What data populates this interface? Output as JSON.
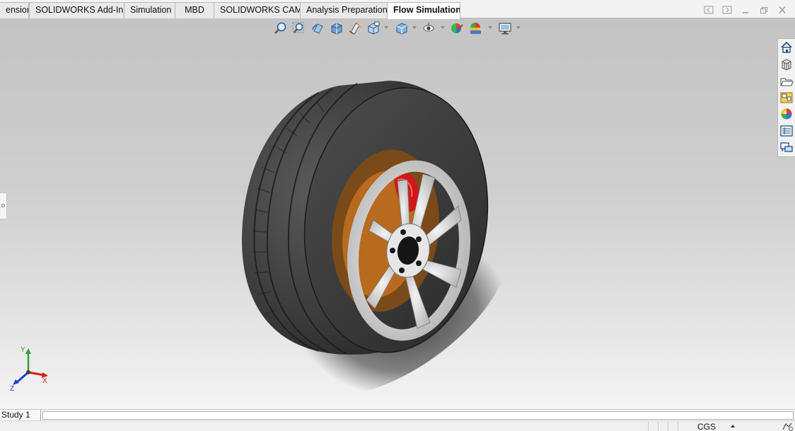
{
  "command_manager": {
    "tabs": [
      {
        "label": "ensions"
      },
      {
        "label": "SOLIDWORKS Add-Ins"
      },
      {
        "label": "Simulation"
      },
      {
        "label": "MBD"
      },
      {
        "label": "SOLIDWORKS CAM"
      },
      {
        "label": "Analysis Preparation"
      },
      {
        "label": "Flow Simulation"
      }
    ],
    "active_tab": "Flow Simulation"
  },
  "window_controls": {
    "icons": [
      "tile-left-icon",
      "tile-right-icon",
      "minimize-icon",
      "restore-icon",
      "close-icon"
    ]
  },
  "heads_up_toolbar": {
    "icons": [
      "zoom-to-fit-icon",
      "zoom-to-area-icon",
      "previous-view-icon",
      "section-view-icon",
      "dynamic-annotation-icon",
      "view-orientation-icon",
      "display-style-icon",
      "hide-show-items-icon",
      "edit-appearance-icon",
      "apply-scene-icon",
      "view-settings-icon"
    ]
  },
  "task_pane": {
    "icons": [
      "home-icon",
      "design-library-icon",
      "file-explorer-icon",
      "view-palette-icon",
      "appearances-icon",
      "custom-properties-icon",
      "forum-icon"
    ]
  },
  "model": {
    "description_icon": "wheel-assembly-model",
    "tire_color": "#3c3c3c",
    "rim_color": "#d8d8d8",
    "caliper_color": "#d01818",
    "rotor_color": "#b86a1e"
  },
  "triad": {
    "x_label": "X",
    "y_label": "Y",
    "z_label": "Z",
    "x_color": "#d02020",
    "y_color": "#30a030",
    "z_color": "#2040d0"
  },
  "study_bar": {
    "study_tab_label": "Study 1"
  },
  "status_bar": {
    "units_label": "CGS",
    "icon": "rebuild-status-icon"
  }
}
